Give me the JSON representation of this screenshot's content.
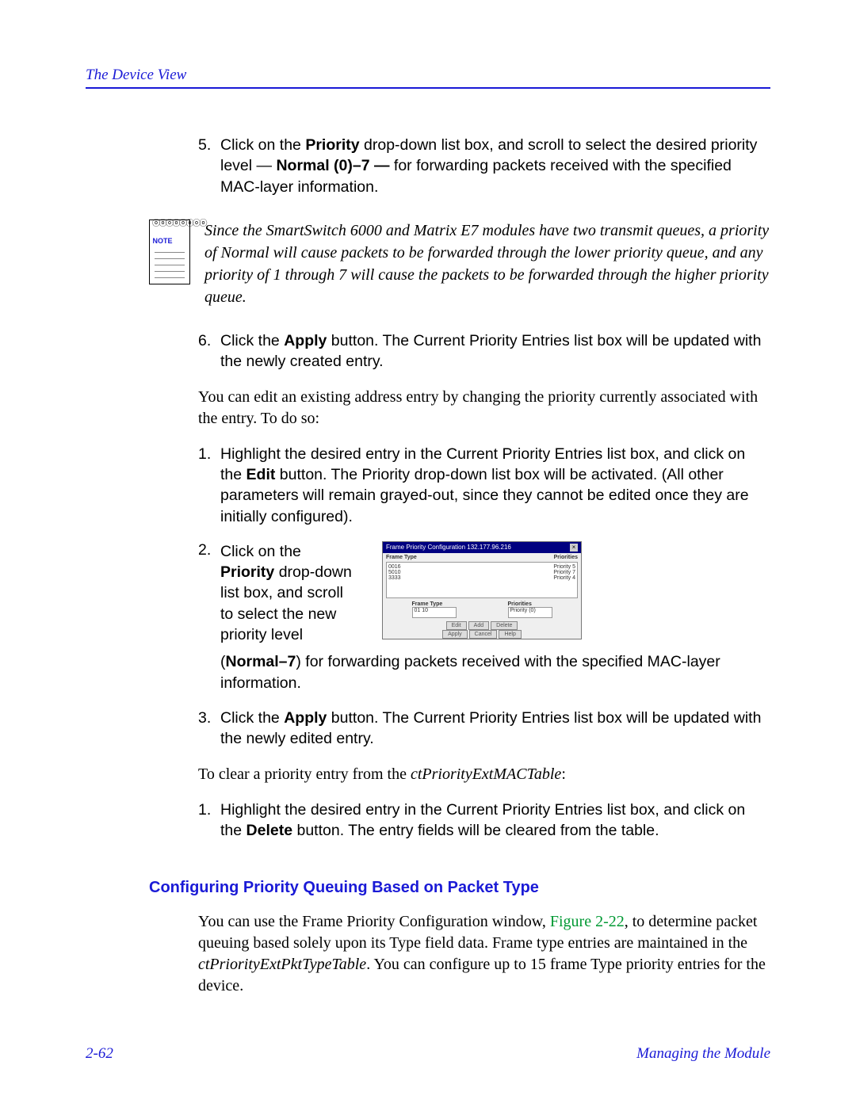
{
  "header": {
    "title": "The Device View"
  },
  "step5": {
    "num": "5.",
    "part1": "Click on the ",
    "bold1": "Priority",
    "part2": " drop-down list box, and scroll to select the desired priority level — ",
    "bold2": "Normal (0)–7 —",
    "part3": " for forwarding packets received with the specified MAC-layer information."
  },
  "note": {
    "label": "NOTE",
    "text": "Since the SmartSwitch 6000 and Matrix E7 modules have two transmit queues, a priority of Normal will cause packets to be forwarded through the lower priority queue, and any priority of 1 through 7 will cause the packets to be forwarded through the higher priority queue."
  },
  "step6": {
    "num": "6.",
    "part1": "Click the ",
    "bold1": "Apply",
    "part2": " button. The Current Priority Entries list box will be updated with the newly created entry."
  },
  "edit_intro": "You can edit an existing address entry by changing the priority currently associated with the entry. To do so:",
  "edit1": {
    "num": "1.",
    "part1": "Highlight the desired entry in the Current Priority Entries list box, and click on the ",
    "bold1": "Edit",
    "part2": " button. The Priority drop-down list box will be activated. (All other parameters will remain grayed-out, since they cannot be edited once they are initially configured)."
  },
  "edit2": {
    "num": "2.",
    "part1": "Click on the ",
    "bold1": "Priority",
    "part2": " drop-down list box, and scroll to select the new priority level"
  },
  "shot": {
    "title": "Frame Priority Configuration  132.177.96.216",
    "col1": "Frame Type",
    "col2": "Priorities",
    "r1a": "0016",
    "r1b": "Priority 5",
    "r2a": "5010",
    "r2b": "Priority 7",
    "r3a": "3333",
    "r3b": "Priority 4",
    "lbl1": "Frame Type",
    "lbl2": "Priorities",
    "in1": "01 10",
    "in2": "Priority (0)",
    "b1": "Edit",
    "b2": "Add",
    "b3": "Delete",
    "b4": "Apply",
    "b5": "Cancel",
    "b6": "Help"
  },
  "edit2_cont": {
    "part1": "(",
    "bold1": "Normal–7",
    "part2": ") for forwarding packets received with the specified MAC-layer information."
  },
  "edit3": {
    "num": "3.",
    "part1": "Click the ",
    "bold1": "Apply",
    "part2": " button. The Current Priority Entries list box will be updated with the newly edited entry."
  },
  "clear_intro": {
    "part1": "To clear a priority entry from the ",
    "ital1": "ctPriorityExtMACTable",
    "part2": ":"
  },
  "clear1": {
    "num": "1.",
    "part1": "Highlight the desired entry in the Current Priority Entries list box, and click on the ",
    "bold1": "Delete",
    "part2": " button. The entry fields will be cleared from the table."
  },
  "heading": "Configuring Priority Queuing Based on Packet Type",
  "body2": {
    "part1": "You can use the Frame Priority Configuration window, ",
    "figref": "Figure 2-22",
    "part2": ", to determine packet queuing based solely upon its Type field data. Frame type entries are maintained in the ",
    "ital1": "ctPriorityExtPktTypeTable",
    "part3": ". You can configure up to 15 frame Type priority entries for the device."
  },
  "footer": {
    "left": "2-62",
    "right": "Managing the Module"
  }
}
